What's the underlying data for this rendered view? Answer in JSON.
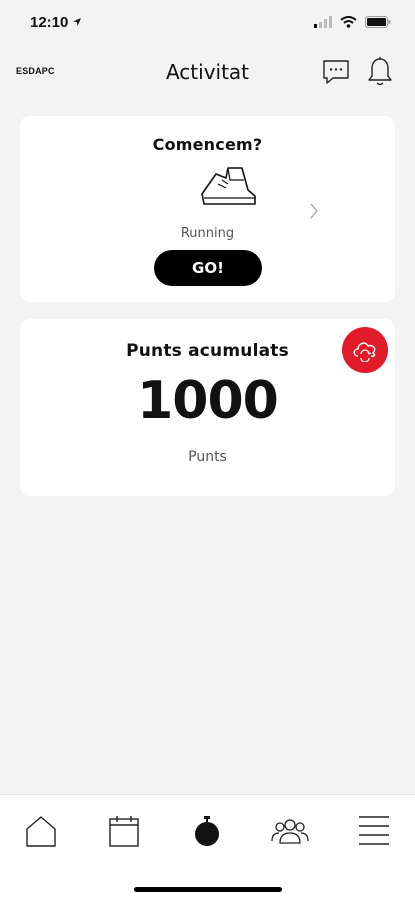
{
  "status_bar": {
    "time": "12:10"
  },
  "header": {
    "logo": "ESDAPC",
    "title": "Activitat"
  },
  "start_card": {
    "title": "Comencem?",
    "activity": "Running",
    "go_label": "GO!"
  },
  "points_card": {
    "title": "Punts acumulats",
    "value": "1000",
    "unit": "Punts"
  },
  "tabs": [
    "home-icon",
    "calendar-icon",
    "stopwatch-icon",
    "group-icon",
    "menu-icon"
  ],
  "colors": {
    "accent_red": "#e21b2a",
    "background": "#f3f3f3"
  }
}
